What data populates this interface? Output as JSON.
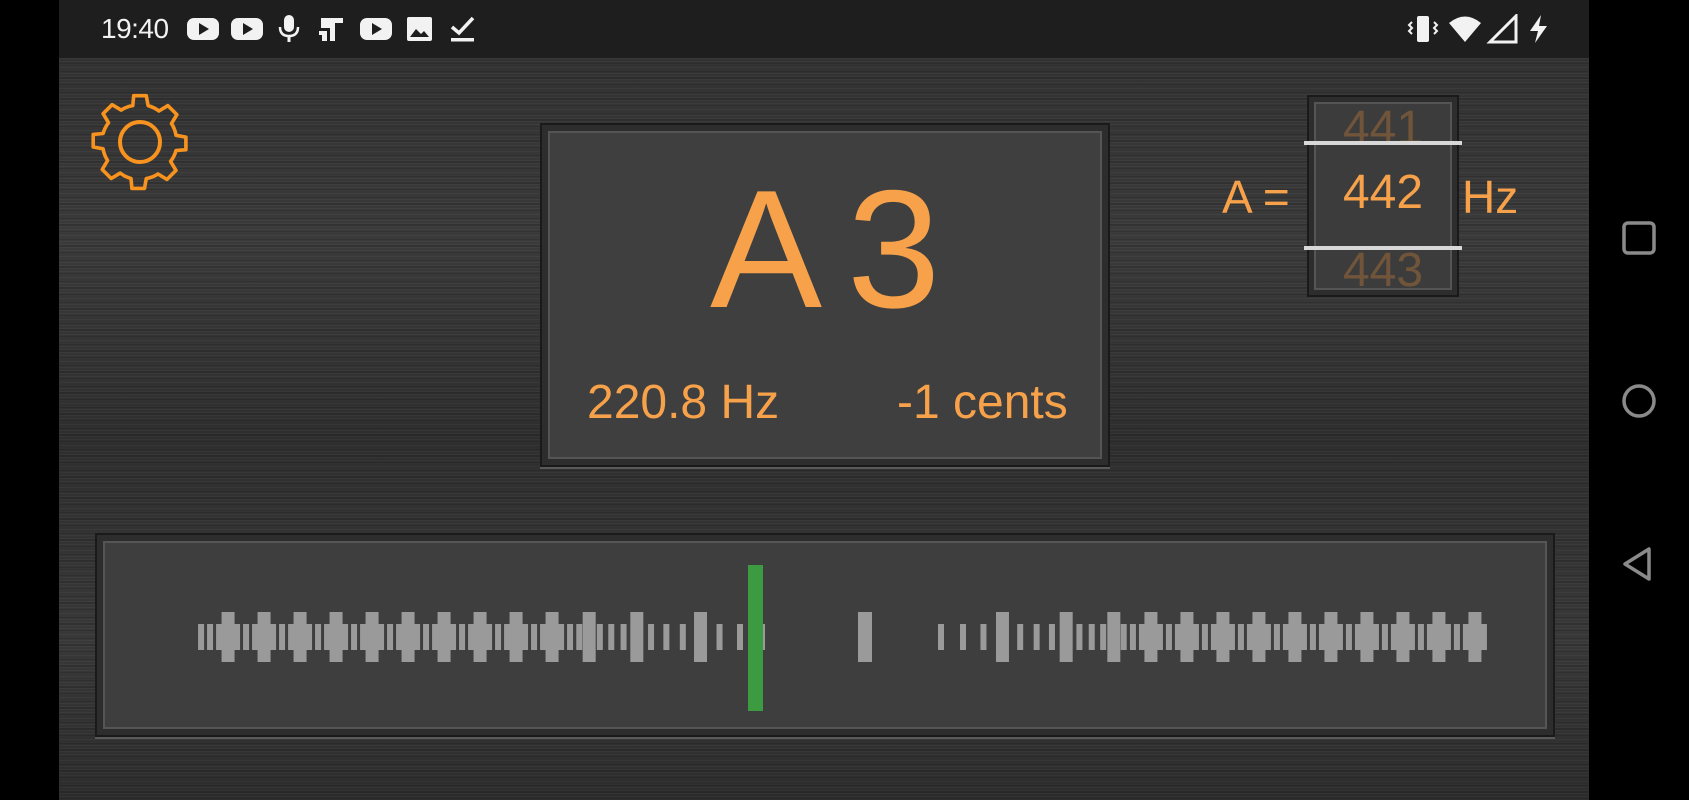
{
  "status_bar": {
    "time": "19:40",
    "left_icons": [
      "youtube-icon",
      "youtube-icon",
      "microphone-icon",
      "jira-icon",
      "youtube-icon",
      "image-icon",
      "download-done-icon"
    ],
    "right_icons": [
      "vibrate-icon",
      "wifi-icon",
      "cell-signal-icon",
      "charging-icon"
    ]
  },
  "tuner": {
    "note": "A",
    "octave": "3",
    "frequency": "220.8 Hz",
    "cents": "-1 cents",
    "cents_offset": -1
  },
  "reference": {
    "label_prefix": "A =",
    "unit": "Hz",
    "previous": "441",
    "current": "442",
    "next": "443"
  },
  "colors": {
    "accent": "#f7a24a",
    "needle": "#3c9a40",
    "tick": "#9a9a9a"
  },
  "navigation": [
    "recent-apps-button",
    "home-button",
    "back-button"
  ]
}
